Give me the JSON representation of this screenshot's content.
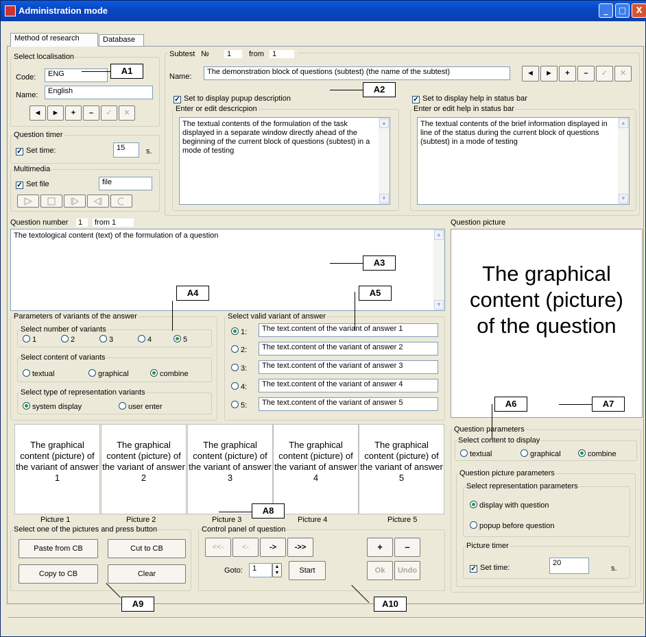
{
  "window": {
    "title": "Administration mode",
    "minimize": "_",
    "maximize": "□",
    "close": "X"
  },
  "tabs": [
    "Method of research",
    "Database"
  ],
  "localisation": {
    "legend": "Select localisation",
    "code_label": "Code:",
    "code": "ENG",
    "name_label": "Name:",
    "name": "English"
  },
  "nav": {
    "prev": "◄",
    "next": "►",
    "add": "+",
    "del": "–",
    "ok": "✓",
    "cancel": "✕"
  },
  "timer": {
    "legend": "Question timer",
    "label": "Set time:",
    "value": "15",
    "unit": "s."
  },
  "multimedia": {
    "legend": "Multimedia",
    "label": "Set file",
    "file": "file"
  },
  "subtest": {
    "label": "Subtest",
    "no": "№",
    "num": "1",
    "from": "from",
    "total": "1",
    "name_label": "Name:",
    "name": "The demonstration block of questions (subtest) (the name of the subtest)"
  },
  "popup": {
    "label": "Set to display pupup description",
    "legend": "Enter or edit descricpion",
    "text": "The textual contents of the formulation of the task displayed in a separate window directly ahead of the beginning of the current block of questions (subtest) in a mode of testing"
  },
  "status": {
    "label": "Set to display help in status bar",
    "legend": "Enter or edit help in status bar",
    "text": "The textual contents of the brief information displayed in line of the status during the current block of questions (subtest) in a mode of testing"
  },
  "question": {
    "label": "Question number",
    "num": "1",
    "from": "from 1",
    "text": "The textological content (text) of the formulation of a question",
    "picture_label": "Question picture",
    "picture_text": "The graphical content (picture) of the question"
  },
  "params": {
    "legend": "Parameters of variants of the answer",
    "num_legend": "Select number of variants",
    "nums": [
      "1",
      "2",
      "3",
      "4",
      "5"
    ],
    "content_legend": "Select content of variants",
    "content": [
      "textual",
      "graphical",
      "combine"
    ],
    "type_legend": "Select type of representation variants",
    "types": [
      "system display",
      "user enter"
    ]
  },
  "valid": {
    "legend": "Select valid variant of answer",
    "items": [
      {
        "n": "1:",
        "t": "The text.content of the variant of answer 1"
      },
      {
        "n": "2:",
        "t": "The text.content of the variant of answer 2"
      },
      {
        "n": "3:",
        "t": "The text.content of the variant of answer 3"
      },
      {
        "n": "4:",
        "t": "The text.content of the variant of answer 4"
      },
      {
        "n": "5:",
        "t": "The text.content of the variant of answer 5"
      }
    ]
  },
  "pictures": [
    {
      "text": "The graphical content (picture) of the variant of answer 1",
      "label": "Picture 1"
    },
    {
      "text": "The graphical content (picture) of the variant of answer 2",
      "label": "Picture 2"
    },
    {
      "text": "The graphical content (picture) of the variant of answer 3",
      "label": "Picture 3"
    },
    {
      "text": "The graphical content (picture) of the variant of answer 4",
      "label": "Picture 4"
    },
    {
      "text": "The graphical content (picture) of the variant of answer 5",
      "label": "Picture 5"
    }
  ],
  "clip": {
    "legend": "Select one of the pictures and press button",
    "paste": "Paste from CB",
    "cut": "Cut to CB",
    "copy": "Copy to CB",
    "clear": "Clear"
  },
  "control": {
    "legend": "Control panel of question",
    "first": "<<-",
    "prev": "<-",
    "next": "->",
    "last": "->>",
    "add": "+",
    "del": "–",
    "ok": "Ok",
    "undo": "Undo",
    "goto_label": "Goto:",
    "goto": "1",
    "start": "Start"
  },
  "qparams": {
    "legend": "Question parameters",
    "content_legend": "Select content to display",
    "content": [
      "textual",
      "graphical",
      "combine"
    ],
    "pic_legend": "Question picture parameters",
    "repr_legend": "Select representation parameters",
    "repr": [
      "display with question",
      "popup before question"
    ],
    "timer_legend": "Picture timer",
    "timer_label": "Set time:",
    "timer_value": "20",
    "timer_unit": "s."
  },
  "callouts": [
    "A1",
    "A2",
    "A3",
    "A4",
    "A5",
    "A6",
    "A7",
    "A8",
    "A9",
    "A10"
  ]
}
